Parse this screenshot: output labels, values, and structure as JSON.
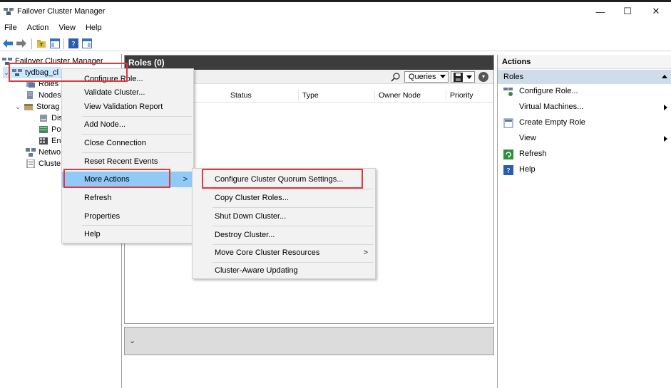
{
  "window": {
    "title": "Failover Cluster Manager",
    "minimize": "—",
    "maximize": "☐",
    "close": "✕"
  },
  "menubar": [
    "File",
    "Action",
    "View",
    "Help"
  ],
  "tree": {
    "root": "Failover Cluster Manager",
    "cluster": "tydbag_cl",
    "roles": "Roles",
    "nodes": "Nodes",
    "storage": "Storag",
    "disks": "Dis",
    "pools": "Po",
    "enclosures": "Enc",
    "networks": "Netwo",
    "cluster_events": "Cluste"
  },
  "center": {
    "header": "Roles (0)",
    "queries": "Queries",
    "columns": [
      "Status",
      "Type",
      "Owner Node",
      "Priority"
    ]
  },
  "bottom_panel": {
    "chevron": "⌄"
  },
  "context_menu": {
    "items": [
      "Configure Role...",
      "Validate Cluster...",
      "View Validation Report",
      "Add Node...",
      "Close Connection",
      "Reset Recent Events",
      "More Actions",
      "Refresh",
      "Properties",
      "Help"
    ],
    "submenu_arrow": ">"
  },
  "submenu": {
    "items": [
      "Configure Cluster Quorum Settings...",
      "Copy Cluster Roles...",
      "Shut Down Cluster...",
      "Destroy Cluster...",
      "Move Core Cluster Resources",
      "Cluster-Aware Updating"
    ],
    "arrow": ">"
  },
  "actions": {
    "header": "Actions",
    "section": "Roles",
    "items": [
      "Configure Role...",
      "Virtual Machines...",
      "Create Empty Role",
      "View",
      "Refresh",
      "Help"
    ]
  },
  "colors": {
    "highlight": "#91c9f7",
    "callout": "#e0383d",
    "header_dark": "#3c3c3c",
    "actions_section": "#cfdcea"
  }
}
